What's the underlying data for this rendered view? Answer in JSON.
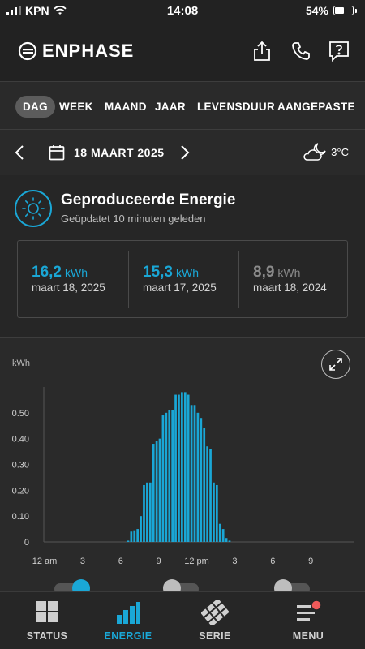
{
  "status_bar": {
    "carrier": "KPN",
    "time": "14:08",
    "battery": "54%",
    "battery_level": 0.54
  },
  "header": {
    "brand": "ENPHASE",
    "icons": [
      "share-icon",
      "phone-icon",
      "help-icon"
    ]
  },
  "tabs": [
    {
      "label": "DAG",
      "active": true
    },
    {
      "label": "WEEK",
      "active": false
    },
    {
      "label": "MAAND",
      "active": false
    },
    {
      "label": "JAAR",
      "active": false
    },
    {
      "label": "LEVENSDUUR",
      "active": false
    },
    {
      "label": "AANGEPASTE",
      "active": false
    }
  ],
  "date_nav": {
    "date": "18 MAART 2025",
    "weather_icon": "partly-cloudy-night-icon",
    "temperature": "3°C"
  },
  "energy": {
    "title": "Geproduceerde Energie",
    "subtitle": "Geüpdatet 10 minuten geleden",
    "stats": [
      {
        "value": "16,2",
        "unit": "kWh",
        "date": "maart 18, 2025",
        "color": "#1aa7d6"
      },
      {
        "value": "15,3",
        "unit": "kWh",
        "date": "maart 17, 2025",
        "color": "#1aa7d6"
      },
      {
        "value": "8,9",
        "unit": "kWh",
        "date": "maart 18, 2024",
        "color": "#8a8a8a"
      }
    ]
  },
  "chart_data": {
    "type": "bar",
    "ylabel": "kWh",
    "y_ticks": [
      "0",
      "0.10",
      "0.20",
      "0.30",
      "0.40",
      "0.50"
    ],
    "ylim": [
      0,
      0.6
    ],
    "x_ticks": [
      "12 am",
      "3",
      "6",
      "9",
      "12 pm",
      "3",
      "6",
      "9"
    ],
    "x_tick_hours": [
      0,
      3,
      6,
      9,
      12,
      15,
      18,
      21
    ],
    "bar_interval_minutes": 15,
    "first_bar_hour": 6.5,
    "bar_color": "#1aa7d6",
    "values": [
      0.005,
      0.04,
      0.045,
      0.05,
      0.1,
      0.22,
      0.23,
      0.23,
      0.38,
      0.39,
      0.4,
      0.49,
      0.5,
      0.51,
      0.51,
      0.57,
      0.57,
      0.58,
      0.58,
      0.57,
      0.53,
      0.53,
      0.5,
      0.48,
      0.44,
      0.37,
      0.36,
      0.23,
      0.22,
      0.07,
      0.05,
      0.015,
      0.005
    ]
  },
  "toggles": [
    {
      "state": "on",
      "color": "#1aa7d6"
    },
    {
      "state": "off",
      "color": "#bdbdbd"
    },
    {
      "state": "off",
      "color": "#bdbdbd"
    }
  ],
  "bottom_nav": [
    {
      "label": "STATUS",
      "icon": "grid-icon",
      "active": false
    },
    {
      "label": "ENERGIE",
      "icon": "bar-chart-icon",
      "active": true
    },
    {
      "label": "SERIE",
      "icon": "solar-panel-icon",
      "active": false
    },
    {
      "label": "MENU",
      "icon": "menu-icon",
      "active": false,
      "badge_color": "#f05a5a"
    }
  ]
}
